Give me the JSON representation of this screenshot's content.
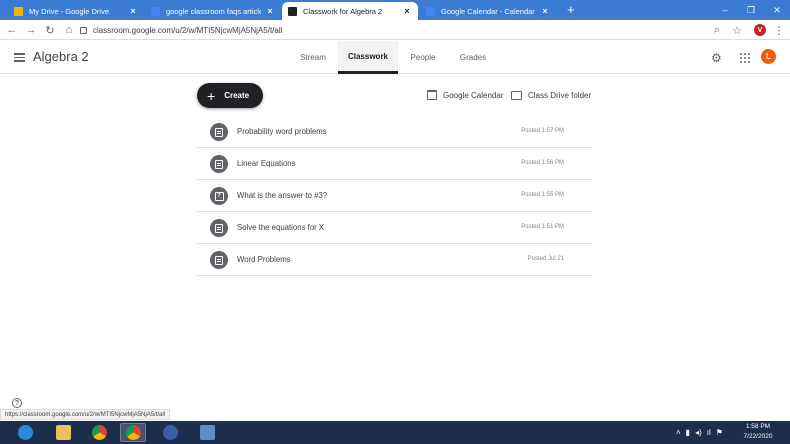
{
  "browser": {
    "tabs": [
      {
        "title": "My Drive - Google Drive",
        "favicon_color": "#f4b400",
        "active": false
      },
      {
        "title": "google classroom faqs article.do",
        "favicon_color": "#4285f4",
        "active": false
      },
      {
        "title": "Classwork for Algebra 2",
        "favicon_color": "#202124",
        "active": true
      },
      {
        "title": "Google Calendar - Calendar setti",
        "favicon_color": "#4285f4",
        "active": false
      }
    ],
    "url": "classroom.google.com/u/2/w/MTI5NjcwMjA5NjA5/t/all",
    "profile_initial": "V",
    "status_url": "https://classroom.google.com/u/2/w/MTI5NjcwMjA5NjA5/t/all"
  },
  "header": {
    "class_name": "Algebra 2",
    "tabs": [
      {
        "label": "Stream",
        "active": false
      },
      {
        "label": "Classwork",
        "active": true
      },
      {
        "label": "People",
        "active": false
      },
      {
        "label": "Grades",
        "active": false
      }
    ],
    "user_initial": "L"
  },
  "toolbar": {
    "create_label": "Create",
    "calendar_label": "Google Calendar",
    "drive_label": "Class Drive folder"
  },
  "assignments": [
    {
      "title": "Probability word problems",
      "posted": "Posted 1:57 PM",
      "icon": "assignment-icon"
    },
    {
      "title": "Linear Equations",
      "posted": "Posted 1:56 PM",
      "icon": "assignment-icon"
    },
    {
      "title": "What is the answer to #3?",
      "posted": "Posted 1:55 PM",
      "icon": "question-icon"
    },
    {
      "title": "Solve the equations for X",
      "posted": "Posted 1:51 PM",
      "icon": "assignment-icon"
    },
    {
      "title": "Word Problems",
      "posted": "Posted Jul 21",
      "icon": "assignment-icon"
    }
  ],
  "taskbar": {
    "time": "1:58 PM",
    "date": "7/22/2020"
  }
}
